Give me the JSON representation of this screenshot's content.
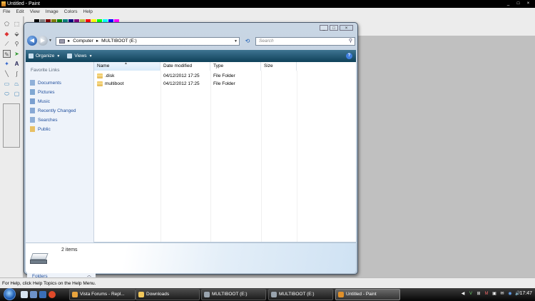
{
  "paint": {
    "title": "Untitled - Paint",
    "menu": [
      "File",
      "Edit",
      "View",
      "Image",
      "Colors",
      "Help"
    ],
    "window_buttons": [
      "_",
      "□",
      "×"
    ],
    "status_text": "For Help, click Help Topics on the Help Menu."
  },
  "explorer": {
    "window_buttons": [
      "_",
      "□",
      "×"
    ],
    "address": {
      "separator": "▸",
      "crumbs": [
        "Computer",
        "MULTIBOOT (E:)"
      ]
    },
    "search_placeholder": "Search",
    "commands": {
      "organize": "Organize",
      "views": "Views"
    },
    "favorite_links_title": "Favorite Links",
    "favorite_links": [
      "Documents",
      "Pictures",
      "Music",
      "Recently Changed",
      "Searches",
      "Public"
    ],
    "folders_label": "Folders",
    "columns": [
      "Name",
      "Date modified",
      "Type",
      "Size"
    ],
    "rows": [
      {
        "name": ".disk",
        "date": "04/12/2012 17:25",
        "type": "File Folder",
        "size": ""
      },
      {
        "name": "multiboot",
        "date": "04/12/2012 17:25",
        "type": "File Folder",
        "size": ""
      }
    ],
    "item_count": "2 items"
  },
  "taskbar": {
    "tasks": [
      {
        "label": "Vista Forums - Repl...",
        "icon_color": "#e8a33d"
      },
      {
        "label": "Downloads",
        "icon_color": "#f1c75b"
      },
      {
        "label": "MULTIBOOT (E:)",
        "icon_color": "#9aa4ae"
      },
      {
        "label": "MULTIBOOT (E:)",
        "icon_color": "#9aa4ae"
      },
      {
        "label": "Untitled - Paint",
        "icon_color": "#e0902a"
      }
    ],
    "tray_icons": [
      "◀",
      "V",
      "⊞",
      "M",
      "▣",
      "✉",
      "◉",
      "🔊"
    ],
    "clock": "17:47"
  }
}
